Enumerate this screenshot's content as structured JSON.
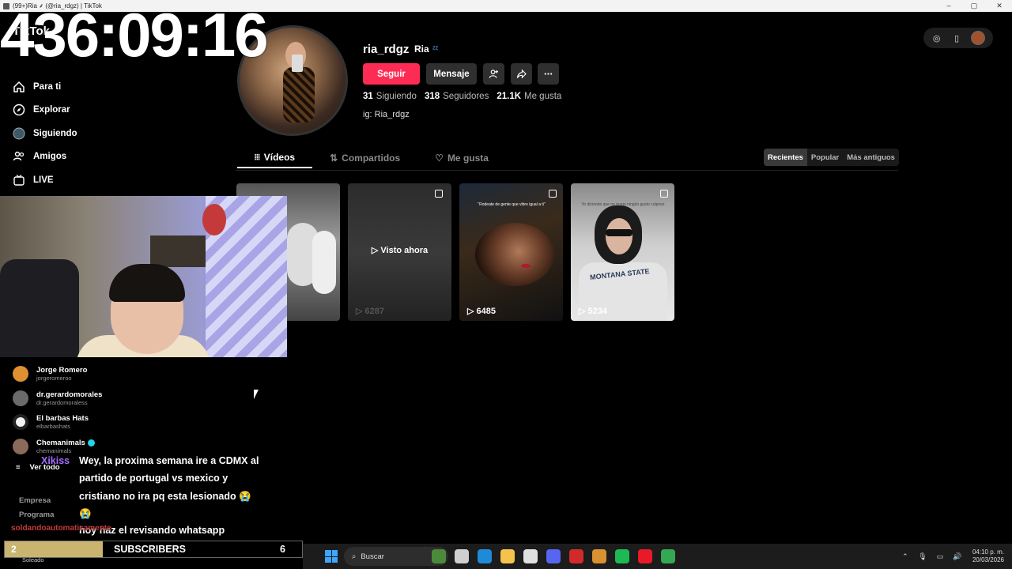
{
  "window": {
    "title": "(99+)Ria ⸙ (@ria_rdgz) | TikTok",
    "controls": [
      "–",
      "▢",
      "✕"
    ]
  },
  "overlay": {
    "timer": "436:09:16",
    "chat_user": "Xikiss",
    "chat_message_1": "Wey, la proxima semana ire a CDMX al partido de portugal vs mexico y cristiano no ira pq esta lesionado 😭 😭",
    "chat_message_2": "hoy haz el revisando whatsapp",
    "chat_user_2": "soldandoautomaticamente",
    "subscribers": {
      "count": "2",
      "label": "SUBSCRIBERS",
      "goal": "6",
      "progress": 0.33
    }
  },
  "sidebar": {
    "logo": "TikTok",
    "nav": [
      {
        "label": "Para ti",
        "icon": "home-icon"
      },
      {
        "label": "Explorar",
        "icon": "compass-icon"
      },
      {
        "label": "Siguiendo",
        "icon": "following-icon"
      },
      {
        "label": "Amigos",
        "icon": "friends-icon"
      },
      {
        "label": "LIVE",
        "icon": "live-icon"
      }
    ],
    "following": [
      {
        "name": "Jorge Romero",
        "handle": "jorgeromeroo",
        "color": "#e09030"
      },
      {
        "name": "dr.gerardomorales",
        "handle": "dr.gerardomoraless",
        "color": "#6a6a6a"
      },
      {
        "name": "El barbas Hats",
        "handle": "elbarbashats",
        "color": "#f2f2f2"
      },
      {
        "name": "Chemanimals",
        "handle": "chemanimals",
        "color": "#8a6a5a",
        "verified": true
      }
    ],
    "see_all": "Ver todo",
    "footer": [
      "Empresa",
      "Programa"
    ]
  },
  "profile": {
    "username": "ria_rdgz",
    "display_name": "Ria",
    "follow_button": "Seguir",
    "message_button": "Mensaje",
    "following_count": "31",
    "following_label": "Siguiendo",
    "followers_count": "318",
    "followers_label": "Seguidores",
    "likes_count": "21.1K",
    "likes_label": "Me gusta",
    "bio": "ig: Ria_rdgz"
  },
  "tabs": [
    {
      "label": "Vídeos",
      "active": true
    },
    {
      "label": "Compartidos",
      "active": false
    },
    {
      "label": "Me gusta",
      "active": false
    }
  ],
  "sort": [
    "Recientes",
    "Popular",
    "Más antiguos"
  ],
  "videos": [
    {
      "views": "",
      "watched": ""
    },
    {
      "views": "6287",
      "watched": "Visto ahora"
    },
    {
      "views": "6485",
      "caption": "\"Rodeate de gente que vibre igual a ti\""
    },
    {
      "views": "5234",
      "caption": "Yo diciendo que no tengo ningún gusto culposo"
    }
  ],
  "taskbar": {
    "search_placeholder": "Buscar",
    "weather": "Soleado",
    "time": "04:10 p. m.",
    "date": "20/03/2026",
    "apps": [
      {
        "name": "widgets-icon",
        "color": "#4a8a3a"
      },
      {
        "name": "taskview-icon",
        "color": "#cfcfcf"
      },
      {
        "name": "edge-icon",
        "color": "#1f8ad8"
      },
      {
        "name": "files-icon",
        "color": "#f5c24c"
      },
      {
        "name": "store-icon",
        "color": "#e0e0e0"
      },
      {
        "name": "discord-icon",
        "color": "#5865f2"
      },
      {
        "name": "news-icon",
        "color": "#d12a2a"
      },
      {
        "name": "app-icon",
        "color": "#d89030"
      },
      {
        "name": "spotify-icon",
        "color": "#1db954"
      },
      {
        "name": "opera-icon",
        "color": "#e81a2a"
      },
      {
        "name": "chrome-icon",
        "color": "#34a853"
      }
    ]
  }
}
